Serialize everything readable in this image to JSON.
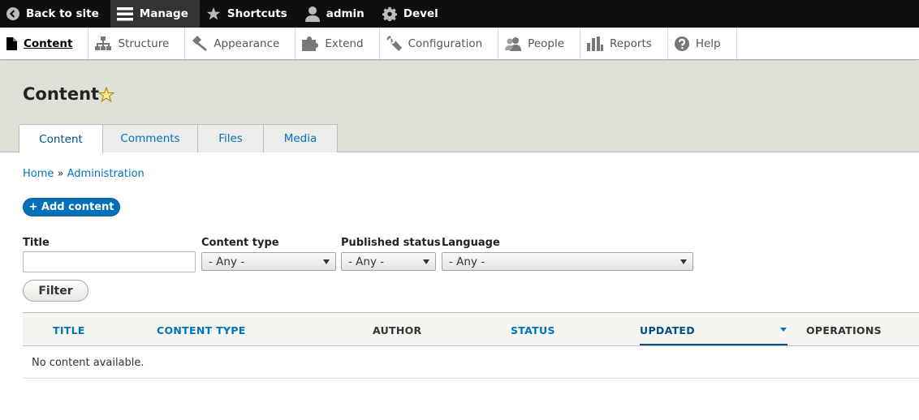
{
  "toolbar": {
    "items": [
      {
        "label": "Back to site",
        "icon": "back-arrow-circle-icon"
      },
      {
        "label": "Manage",
        "icon": "hamburger-menu-icon"
      },
      {
        "label": "Shortcuts",
        "icon": "star-icon"
      },
      {
        "label": "admin",
        "icon": "user-icon"
      },
      {
        "label": "Devel",
        "icon": "gear-icon"
      }
    ]
  },
  "tray": {
    "items": [
      {
        "label": "Content",
        "icon": "file-icon"
      },
      {
        "label": "Structure",
        "icon": "sitemap-icon"
      },
      {
        "label": "Appearance",
        "icon": "paintbrush-icon"
      },
      {
        "label": "Extend",
        "icon": "puzzle-icon"
      },
      {
        "label": "Configuration",
        "icon": "wrench-icon"
      },
      {
        "label": "People",
        "icon": "people-icon"
      },
      {
        "label": "Reports",
        "icon": "bar-chart-icon"
      },
      {
        "label": "Help",
        "icon": "question-icon"
      }
    ]
  },
  "page": {
    "title": "Content"
  },
  "tabs": [
    "Content",
    "Comments",
    "Files",
    "Media"
  ],
  "breadcrumb": {
    "home": "Home",
    "separator": "»",
    "admin": "Administration"
  },
  "actions": {
    "add_content": "+ Add content"
  },
  "filters": {
    "title_label": "Title",
    "title_value": "",
    "content_type_label": "Content type",
    "content_type_value": "- Any -",
    "published_label": "Published status",
    "published_value": "- Any -",
    "language_label": "Language",
    "language_value": "- Any -",
    "filter_button": "Filter"
  },
  "table": {
    "headers": [
      "TITLE",
      "CONTENT TYPE",
      "AUTHOR",
      "STATUS",
      "UPDATED",
      "OPERATIONS"
    ],
    "empty": "No content available."
  },
  "colors": {
    "accent": "#0074bd",
    "toolbar": "#0f0f0f",
    "header_band": "#e0e0d8",
    "primary_button": "#0071b8"
  }
}
